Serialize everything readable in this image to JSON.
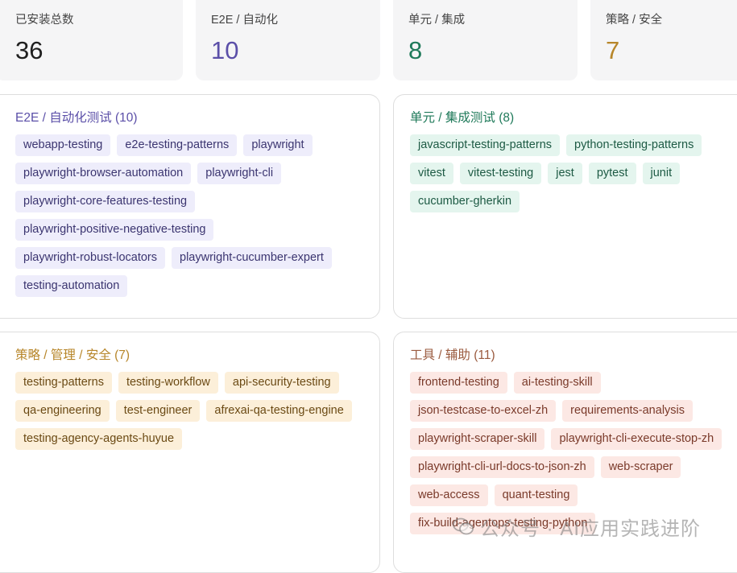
{
  "stats": [
    {
      "label": "已安装总数",
      "value": "36",
      "color": "#1f1f1f"
    },
    {
      "label": "E2E / 自动化",
      "value": "10",
      "color": "#5b4fa8"
    },
    {
      "label": "单元 / 集成",
      "value": "8",
      "color": "#1f7a5a"
    },
    {
      "label": "策略 / 安全",
      "value": "7",
      "color": "#b7862a"
    }
  ],
  "panels": [
    {
      "title": "E2E / 自动化测试 (10)",
      "title_color": "#5b4fa8",
      "tag_bg": "#eeedfb",
      "tag_color": "#3b3570",
      "tags": [
        "webapp-testing",
        "e2e-testing-patterns",
        "playwright",
        "playwright-browser-automation",
        "playwright-cli",
        "playwright-core-features-testing",
        "playwright-positive-negative-testing",
        "playwright-robust-locators",
        "playwright-cucumber-expert",
        "testing-automation"
      ]
    },
    {
      "title": "单元 / 集成测试 (8)",
      "title_color": "#1f7a5a",
      "tag_bg": "#e4f5ee",
      "tag_color": "#1d5a44",
      "tags": [
        "javascript-testing-patterns",
        "python-testing-patterns",
        "vitest",
        "vitest-testing",
        "jest",
        "pytest",
        "junit",
        "cucumber-gherkin"
      ]
    },
    {
      "title": "策略 / 管理 / 安全 (7)",
      "title_color": "#b7862a",
      "tag_bg": "#fcefd9",
      "tag_color": "#6b4a14",
      "tags": [
        "testing-patterns",
        "testing-workflow",
        "api-security-testing",
        "qa-engineering",
        "test-engineer",
        "afrexai-qa-testing-engine",
        "testing-agency-agents-huyue"
      ]
    },
    {
      "title": "工具 / 辅助 (11)",
      "title_color": "#9a5a3e",
      "tag_bg": "#fce8e4",
      "tag_color": "#7a3a2a",
      "tags": [
        "frontend-testing",
        "ai-testing-skill",
        "json-testcase-to-excel-zh",
        "requirements-analysis",
        "playwright-scraper-skill",
        "playwright-cli-execute-stop-zh",
        "playwright-cli-url-docs-to-json-zh",
        "web-scraper",
        "web-access",
        "quant-testing",
        "fix-build-agentops-testing-python"
      ]
    }
  ],
  "watermark": {
    "text": "公众号 · AI应用实践进阶",
    "icon": "wechat-icon"
  }
}
